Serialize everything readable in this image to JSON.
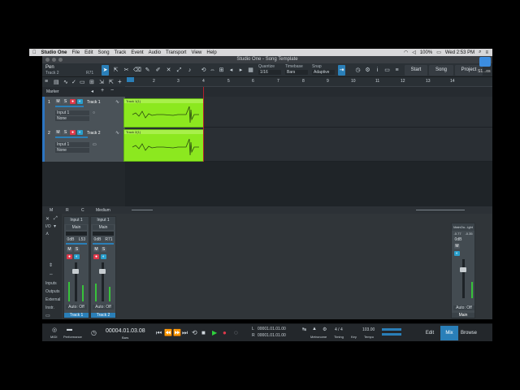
{
  "menubar": {
    "apple": "",
    "items": [
      "Studio One",
      "File",
      "Edit",
      "Song",
      "Track",
      "Event",
      "Audio",
      "Transport",
      "View",
      "Help"
    ],
    "battery": "100%",
    "clock": "Wed 2:53 PM"
  },
  "window": {
    "title": "Studio One - Song Template"
  },
  "toolbar": {
    "tool_name": "Pen",
    "track_name": "Track 2",
    "track_pos": "R71",
    "quantize_label": "Quantize",
    "quantize_value": "1/16",
    "timebase_label": "Timebase",
    "timebase_value": "Bars",
    "snap_label": "Snap",
    "snap_value": "Adaptive",
    "start_label": "Start",
    "song_label": "Song",
    "project_label": "Project"
  },
  "ruler": {
    "marks": [
      "2",
      "3",
      "4",
      "5",
      "6",
      "7",
      "8",
      "9",
      "10",
      "11",
      "12",
      "13",
      "14"
    ]
  },
  "marker_label": "Marker",
  "tracks": [
    {
      "num": "1",
      "name": "Track 1",
      "input": "Input 1",
      "output": "None",
      "event": "Track 1(1)"
    },
    {
      "num": "2",
      "name": "Track 2",
      "input": "Input 1",
      "output": "None",
      "event": "Track 2(1)"
    }
  ],
  "arrange_footer": {
    "m": "M",
    "r": "R",
    "c": "C",
    "size": "Medium"
  },
  "mixer": {
    "side": {
      "io": "I/O",
      "inputs": "Inputs",
      "outputs": "Outputs",
      "external": "External",
      "instr": "Instr."
    },
    "strips": [
      {
        "input": "Input 1",
        "bus": "Main",
        "gain": "0dB",
        "pan": "L53",
        "auto": "Auto: Off",
        "name": "Track 1"
      },
      {
        "input": "Input 1",
        "bus": "Main",
        "gain": "0dB",
        "pan": "R71",
        "auto": "Auto: Off",
        "name": "Track 2"
      }
    ],
    "main": {
      "name": "MainOu...ight",
      "val1": "-0.77",
      "val2": "-0.35",
      "gain": "0dB",
      "auto": "Auto: Off",
      "label": "Main"
    }
  },
  "transport": {
    "midi": "MIDI",
    "performance": "Performance",
    "time": "00004.01.03.08",
    "time_unit": "Bars",
    "loop_l": "00001.01.01.00",
    "loop_r": "00001.01.01.00",
    "metronome": "Metronome",
    "timing_sig": "4 / 4",
    "timing": "Timing",
    "key": "Key",
    "tempo_val": "103.00",
    "tempo": "Tempo",
    "edit": "Edit",
    "mix": "Mix",
    "browse": "Browse"
  },
  "colors": {
    "accent": "#2a7fb8",
    "event": "#8ce81f",
    "record": "#e0384a"
  }
}
